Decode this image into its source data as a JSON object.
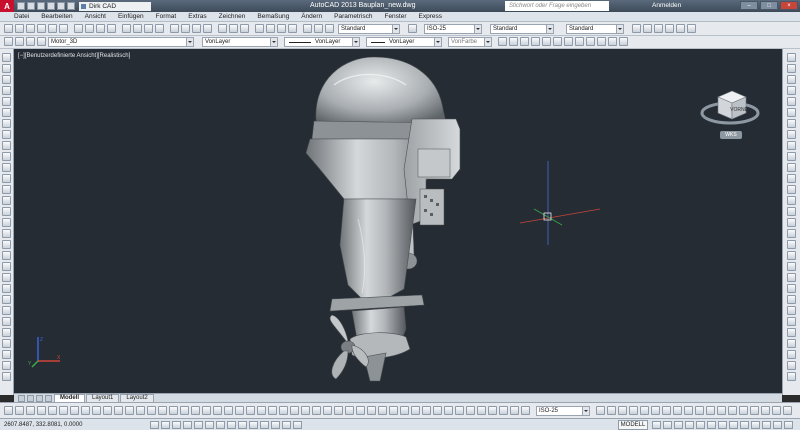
{
  "titlebar": {
    "logo": "A",
    "workspace": "Dirk CAD",
    "title": "AutoCAD 2013   Bauplan_new.dwg",
    "search_placeholder": "Stichwort oder Frage eingeben",
    "login": "Anmelden"
  },
  "menu": [
    "Datei",
    "Bearbeiten",
    "Ansicht",
    "Einfügen",
    "Format",
    "Extras",
    "Zeichnen",
    "Bemaßung",
    "Ändern",
    "Parametrisch",
    "Fenster",
    "Express"
  ],
  "styles": {
    "text_style": "Standard",
    "dim_style": "ISO-25",
    "table_style": "Standard",
    "mleader_style": "Standard"
  },
  "layers": {
    "current_layer": "Motor_3D",
    "color": "VonLayer",
    "linetype": "VonLayer",
    "lineweight": "VonLayer",
    "plotstyle": "VonFarbe"
  },
  "viewport": {
    "label": "[−][Benutzerdefinierte Ansicht][Realistisch]",
    "viewcube_face": "VORNE",
    "wcs_label": "WKS",
    "background": "#252c33"
  },
  "tabs": [
    "Modell",
    "Layout1",
    "Layout2"
  ],
  "bottom_toolbar": {
    "dim_style": "ISO-25"
  },
  "statusbar": {
    "coordinates": "2607.8487, 332.8081, 0.0000",
    "model_label": "MODELL"
  }
}
